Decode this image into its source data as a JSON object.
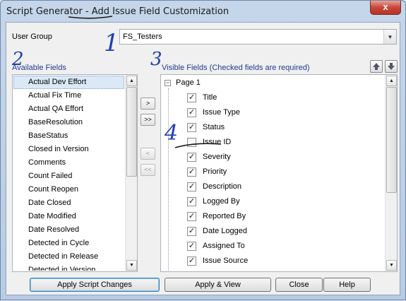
{
  "window": {
    "title": "Script Generator - Add Issue Field Customization",
    "close_glyph": "x"
  },
  "user_group": {
    "label": "User Group",
    "value": "FS_Testers"
  },
  "available": {
    "label": "Available Fields",
    "items": [
      "Actual Dev Effort",
      "Actual Fix Time",
      "Actual QA Effort",
      "BaseResolution",
      "BaseStatus",
      "Closed in Version",
      "Comments",
      "Count Failed",
      "Count Reopen",
      "Date Closed",
      "Date Modified",
      "Date Resolved",
      "Detected in Cycle",
      "Detected in Release",
      "Detected in Version"
    ],
    "selected_index": 0
  },
  "move_buttons": {
    "add_one": ">",
    "add_all": ">>",
    "remove_one": "<",
    "remove_all": "<<"
  },
  "visible": {
    "label": "Visible Fields (Checked fields are required)",
    "root": "Page 1",
    "items": [
      {
        "label": "Title",
        "checked": true
      },
      {
        "label": "Issue Type",
        "checked": true
      },
      {
        "label": "Status",
        "checked": true
      },
      {
        "label": "Issue ID",
        "checked": false
      },
      {
        "label": "Severity",
        "checked": true
      },
      {
        "label": "Priority",
        "checked": true
      },
      {
        "label": "Description",
        "checked": true
      },
      {
        "label": "Logged By",
        "checked": true
      },
      {
        "label": "Reported By",
        "checked": true
      },
      {
        "label": "Date Logged",
        "checked": true
      },
      {
        "label": "Assigned To",
        "checked": true
      },
      {
        "label": "Issue Source",
        "checked": true
      }
    ]
  },
  "buttons": {
    "apply": "Apply Script Changes",
    "apply_view": "Apply & View",
    "close": "Close",
    "help": "Help"
  },
  "annotations": [
    "1",
    "2",
    "3",
    "4"
  ],
  "colors": {
    "annotation": "#1d3fb5",
    "list_selection": "#dbe8f6"
  }
}
